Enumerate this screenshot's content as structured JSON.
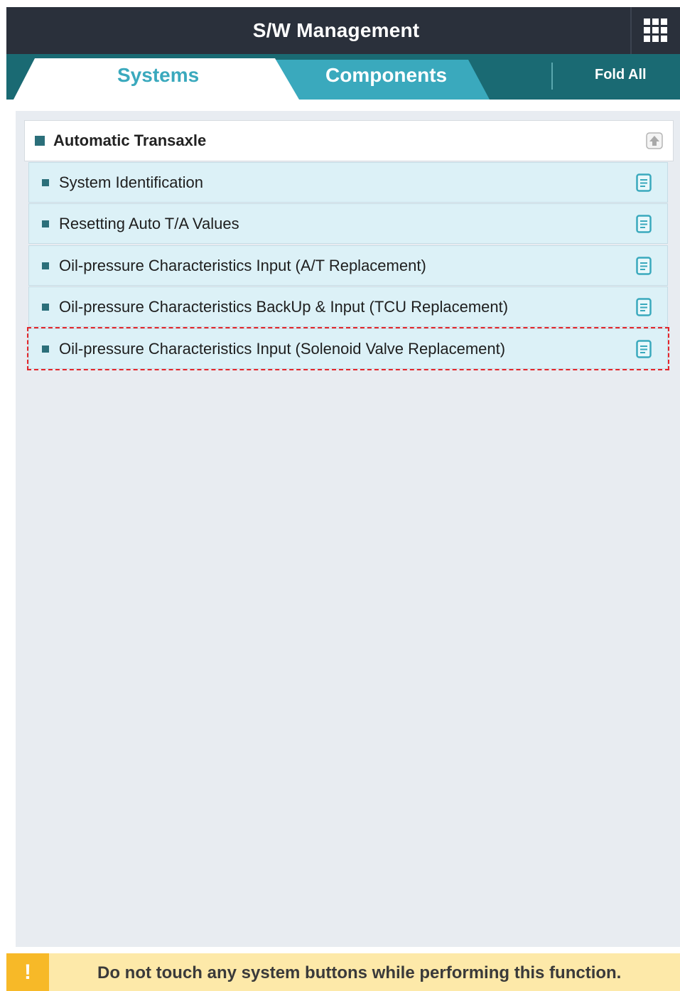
{
  "header": {
    "title": "S/W Management",
    "menu_icon": "grid-menu-icon"
  },
  "tabs": [
    {
      "label": "Systems",
      "active": true
    },
    {
      "label": "Components",
      "active": false
    }
  ],
  "fold_all_label": "Fold All",
  "group": {
    "title": "Automatic Transaxle",
    "collapse_icon": "collapse-up-icon"
  },
  "items": [
    {
      "label": "System Identification",
      "icon": "document-icon",
      "selected": false
    },
    {
      "label": "Resetting Auto T/A Values",
      "icon": "document-icon",
      "selected": false
    },
    {
      "label": "Oil-pressure Characteristics Input (A/T Replacement)",
      "icon": "document-icon",
      "selected": false
    },
    {
      "label": "Oil-pressure Characteristics BackUp & Input (TCU Replacement)",
      "icon": "document-icon",
      "selected": false
    },
    {
      "label": "Oil-pressure Characteristics Input (Solenoid Valve Replacement)",
      "icon": "document-icon",
      "selected": true
    }
  ],
  "footer": {
    "warning_glyph": "!",
    "message": "Do not touch any system buttons while performing this function."
  },
  "colors": {
    "header_bg": "#2a303b",
    "tab_bar_bg": "#1a6a73",
    "components_tab_bg": "#3aa9bd",
    "accent": "#3aa9bd",
    "item_bg": "#dcf1f7",
    "selection_outline": "#e3262b",
    "warning_bg": "#fde9a9",
    "warning_icon_bg": "#f7b928"
  }
}
